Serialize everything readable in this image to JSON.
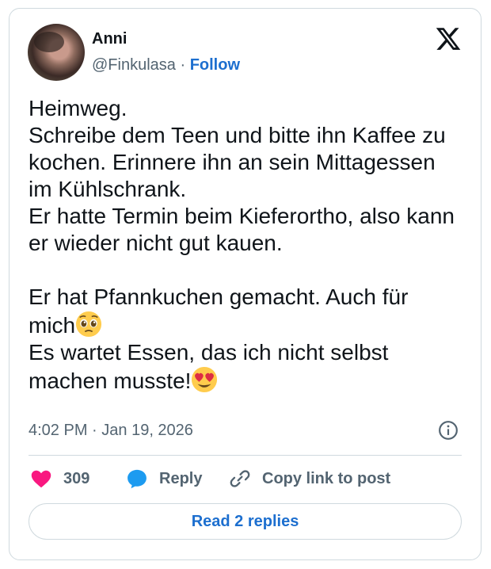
{
  "author": {
    "name": "Anni",
    "handle": "@Finkulasa",
    "separator": " · ",
    "follow_label": "Follow"
  },
  "tweet": {
    "text_main": "Heimweg.\nSchreibe dem Teen und bitte ihn Kaffee zu kochen. Erinnere ihn an sein Mittagessen im Kühlschrank.\nEr hatte Termin beim Kieferortho, also kann er wieder nicht gut kauen.\n\nEr hat Pfannkuchen gemacht. Auch für mich",
    "emoji_1": "pleading-face-emoji",
    "text_line2": "\nEs wartet Essen, das ich nicht selbst machen musste!",
    "emoji_2": "heart-eyes-emoji"
  },
  "meta": {
    "time": "4:02 PM",
    "separator": " · ",
    "date": "Jan 19, 2026"
  },
  "actions": {
    "like_count": "309",
    "reply_label": "Reply",
    "copy_label": "Copy link to post"
  },
  "read_replies_label": "Read 2 replies",
  "icons": {
    "brand": "x-logo-icon",
    "info": "info-icon",
    "like": "heart-icon",
    "reply": "speech-bubble-icon",
    "copy": "link-icon"
  },
  "colors": {
    "link": "#1d6fcf",
    "like": "#f91880",
    "reply": "#1d9bf0",
    "muted": "#536471",
    "border": "#cfd9de"
  }
}
